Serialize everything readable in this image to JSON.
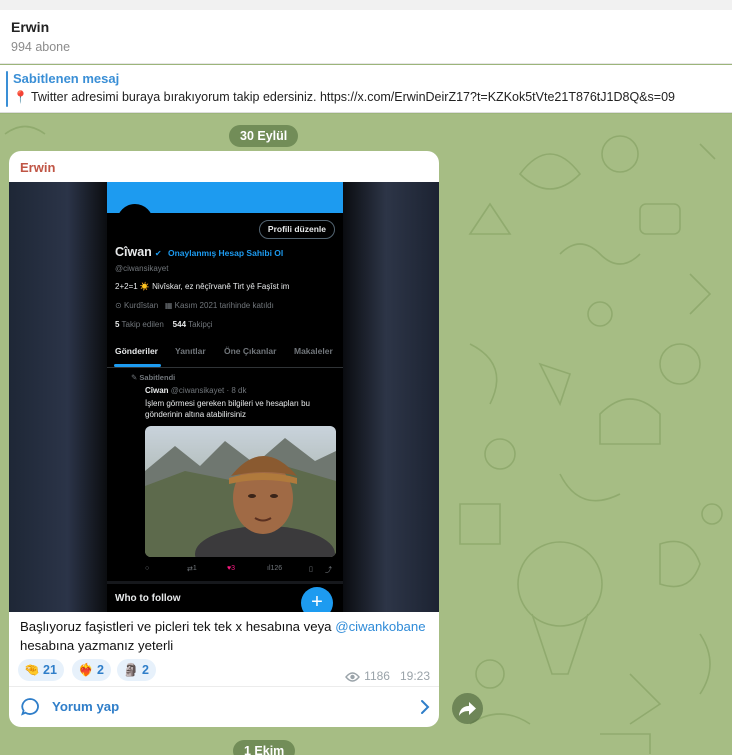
{
  "channel": {
    "name": "Erwin",
    "subscribers": "994 abone"
  },
  "pinned": {
    "title": "Sabitlenen mesaj",
    "icon": "round-pushpin-icon",
    "text": "Twitter adresimi buraya bırakıyorum takip edersiniz.  https://x.com/ErwinDeirZ17?t=KZKok5tVte21T876tJ1D8Q&s=09"
  },
  "dates": {
    "first": "30 Eylül",
    "second": "1 Ekim"
  },
  "message": {
    "sender": "Erwin",
    "text_before_link": "Başlıyoruz faşistleri ve picleri tek tek x hesabına veya ",
    "link": "@ciwankobane",
    "text_after_link": " hesabına yazmanız yeterli",
    "reactions": [
      {
        "emoji_name": "pinching-hand-emoji",
        "emoji": "🤏",
        "count": "21"
      },
      {
        "emoji_name": "heart-on-fire-emoji",
        "emoji": "❤️‍🔥",
        "count": "2"
      },
      {
        "emoji_name": "moai-emoji",
        "emoji": "🗿",
        "count": "2"
      }
    ],
    "views": "1186",
    "time": "19:23",
    "comments_label": "Yorum yap"
  },
  "screenshot": {
    "edit_profile": "Profili düzenle",
    "display_name": "Cîwan",
    "verify_cta": "Onaylanmış Hesap Sahibi Ol",
    "handle": "@ciwansikayet",
    "bio": "2+2=1 ☀️  Nivîskar, ez nêçîrvanê Tirt yê Faşîst im",
    "location": "Kurdîstan",
    "joined": "Kasım 2021 tarihinde katıldı",
    "following_count": "5",
    "following_label": "Takip edilen",
    "followers_count": "544",
    "followers_label": "Takipçi",
    "tabs": [
      "Gönderiler",
      "Yanıtlar",
      "Öne Çıkanlar",
      "Makaleler"
    ],
    "pinned_label": "Sabitlendi",
    "tweet_author": "Cîwan",
    "tweet_meta": "@ciwansikayet · 8 dk",
    "tweet_text": "İşlem görmesi gereken bilgileri ve hesapları bu gönderinin altına  atabilirsiniz",
    "retweets": "1",
    "likes": "3",
    "views": "126",
    "who_to_follow": "Who to follow",
    "fab": "+"
  },
  "colors": {
    "accent": "#2f7ec9",
    "sender": "#c05545",
    "twitter_blue": "#1d9bf0",
    "chat_bg": "#a6bd84"
  }
}
